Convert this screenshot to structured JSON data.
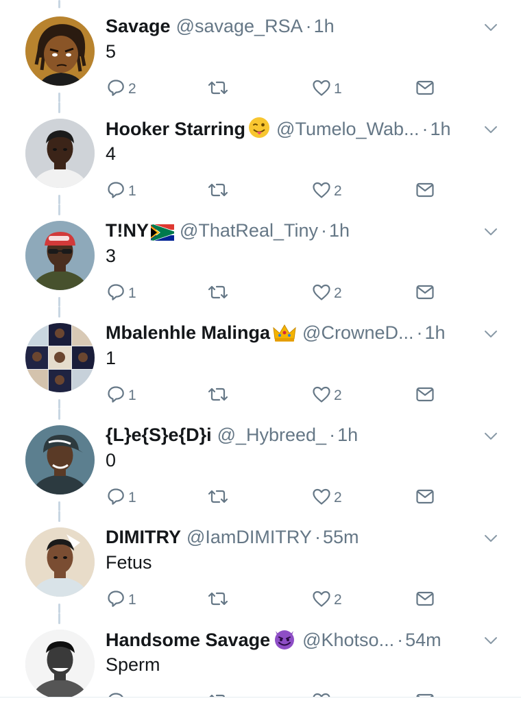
{
  "tweets": [
    {
      "name": "Savage",
      "handle": "@savage_RSA",
      "dot": "·",
      "time": "1h",
      "text": "5",
      "replies": "2",
      "retweets": "",
      "likes": "1",
      "emoji": "",
      "avatar": "cartoon"
    },
    {
      "name": "Hooker Starring",
      "handle": "@Tumelo_Wab...",
      "dot": "·",
      "time": "1h",
      "text": "4",
      "replies": "1",
      "retweets": "",
      "likes": "2",
      "emoji": "winking-tongue-emoji",
      "avatar": "person-light"
    },
    {
      "name": "T!NY",
      "handle": "@ThatReal_Tiny",
      "dot": "·",
      "time": "1h",
      "text": "3",
      "replies": "1",
      "retweets": "",
      "likes": "2",
      "emoji": "south-africa-flag",
      "avatar": "person-cap"
    },
    {
      "name": "Mbalenhle Malinga",
      "handle": "@CrowneD...",
      "dot": "·",
      "time": "1h",
      "text": "1",
      "replies": "1",
      "retweets": "",
      "likes": "2",
      "emoji": "crown-emoji",
      "avatar": "collage"
    },
    {
      "name": "{L}e{S}e{D}i",
      "handle": "@_Hybreed_",
      "dot": "·",
      "time": "1h",
      "text": "0",
      "replies": "1",
      "retweets": "",
      "likes": "2",
      "emoji": "",
      "avatar": "person-hat"
    },
    {
      "name": "DIMITRY",
      "handle": "@IamDIMITRY",
      "dot": "·",
      "time": "55m",
      "text": "Fetus",
      "replies": "1",
      "retweets": "",
      "likes": "2",
      "emoji": "",
      "avatar": "person-warm"
    },
    {
      "name": "Handsome Savage",
      "handle": "@Khotso...",
      "dot": "·",
      "time": "54m",
      "text": "Sperm",
      "replies": "",
      "retweets": "",
      "likes": "",
      "emoji": "smiling-devil-emoji",
      "avatar": "person-bw"
    }
  ],
  "colors": {
    "text": "#14171a",
    "secondary": "#657786",
    "icon": "#657786",
    "thread_line": "#c8d6e2",
    "background": "#ffffff"
  },
  "icons": [
    "reply-icon",
    "retweet-icon",
    "like-icon",
    "direct-message-icon",
    "chevron-down-icon"
  ]
}
